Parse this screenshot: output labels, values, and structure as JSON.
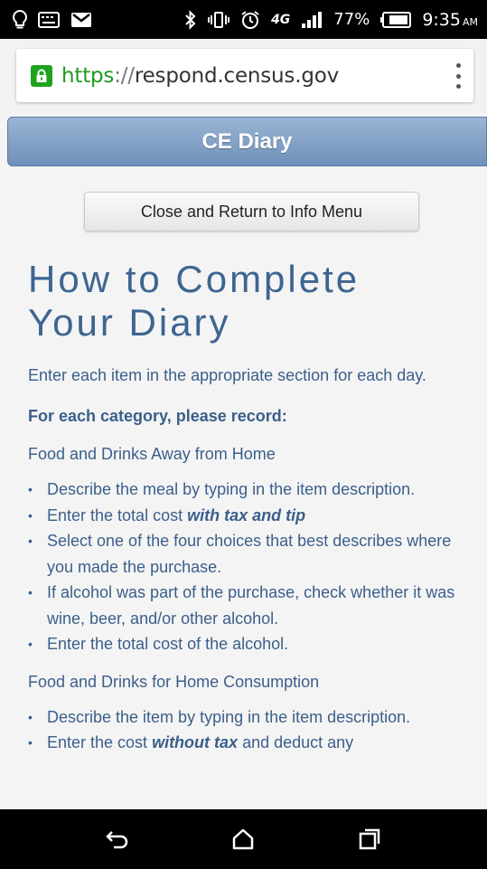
{
  "status_bar": {
    "battery_percent": "77%",
    "time": "9:35",
    "ampm": "AM",
    "network": "4G",
    "icons": [
      "lightbulb-icon",
      "keyboard-icon",
      "gmail-icon",
      "bluetooth-icon",
      "vibrate-icon",
      "alarm-icon",
      "lte-icon",
      "signal-icon",
      "battery-icon"
    ]
  },
  "browser": {
    "url_scheme": "https",
    "url_sep": "://",
    "url_host": "respond.census.gov"
  },
  "header": {
    "title": "CE Diary"
  },
  "close_button": {
    "label": "Close and Return to Info Menu"
  },
  "content": {
    "heading_line1": "How to Complete",
    "heading_line2": "Your Diary",
    "intro": "Enter each item in the appropriate section for each day.",
    "subheading": "For each category, please record:",
    "section1": {
      "title": "Food and Drinks Away from Home",
      "items": [
        "Describe the meal by typing in the item description.",
        "Enter the total cost ",
        "Select one of the four choices that best describes where you made the purchase.",
        "If alcohol was part of the purchase, check whether it was wine, beer, and/or other alcohol.",
        "Enter the total cost of the alcohol."
      ],
      "item2_emphasis": "with tax and tip"
    },
    "section2": {
      "title": "Food and Drinks for Home Consumption",
      "items": [
        "Describe the item by typing in the item description.",
        "Enter the cost "
      ],
      "item2_emphasis": "without tax",
      "item2_suffix": " and deduct any"
    }
  },
  "colors": {
    "header_gradient_top": "#9ab5d6",
    "header_gradient_bottom": "#6f90b8",
    "text_blue": "#3b5f8a",
    "lock_green": "#1fa31f"
  }
}
